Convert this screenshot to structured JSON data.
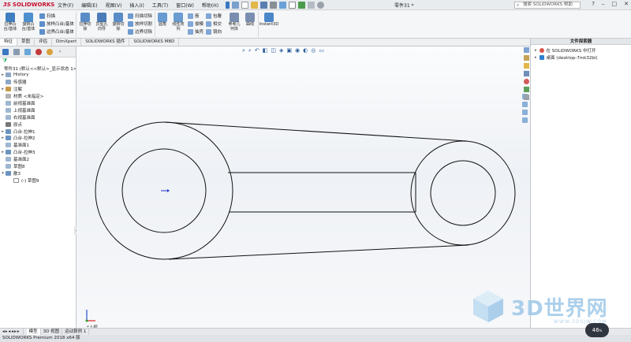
{
  "app": {
    "logo_text": "SOLIDWORKS",
    "document_title": "零件31 *",
    "search_placeholder": "搜索 SOLIDWORKS 帮助",
    "menus": [
      "文件(F)",
      "编辑(E)",
      "视图(V)",
      "插入(I)",
      "工具(T)",
      "窗口(W)",
      "帮助(H)"
    ],
    "window_controls": [
      "?",
      "–",
      "□",
      "✕"
    ]
  },
  "ribbon": {
    "features": [
      {
        "label": "拉伸凸\n台/基体",
        "color": "#3f7fc0"
      },
      {
        "label": "旋转凸\n台/基体",
        "color": "#4e8fce"
      }
    ],
    "boss_small": [
      "扫描",
      "放样凸台/基体",
      "边界凸台/基体"
    ],
    "cuts": [
      {
        "label": "拉伸切\n除",
        "color": "#5a8dc8"
      },
      {
        "label": "异型孔\n向导",
        "color": "#4b7cb8"
      },
      {
        "label": "旋转切\n除",
        "color": "#5a8dc8"
      }
    ],
    "cut_small": [
      "扫描切除",
      "放样切割",
      "边界切除"
    ],
    "fillet": {
      "label": "圆角",
      "color": "#6a9bd1"
    },
    "pattern": {
      "label": "线性阵\n列",
      "color": "#6a9bd1"
    },
    "rib_small": [
      "筋",
      "拔模",
      "抽壳"
    ],
    "wrap_small": [
      "包覆",
      "相交",
      "镜向"
    ],
    "ref_geom": {
      "label": "参考几\n何体",
      "color": "#7a8fb0"
    },
    "curves": {
      "label": "曲线",
      "color": "#7a8fb0"
    },
    "instant3d": {
      "label": "Instant3D",
      "color": "#4a87c9"
    }
  },
  "command_tabs": [
    "特征",
    "草图",
    "评估",
    "DimXpert",
    "SOLIDWORKS 插件",
    "SOLIDWORKS MBD"
  ],
  "feature_tree": {
    "root": "零件31 (默认<<默认>_显示状态 1>)",
    "items": [
      {
        "label": "History",
        "arrow": "▸",
        "color": "#8da7c6"
      },
      {
        "label": "传感器",
        "arrow": "",
        "color": "#8da7c6"
      },
      {
        "label": "注解",
        "arrow": "▸",
        "color": "#c69a4a"
      },
      {
        "label": "材质 <未指定>",
        "arrow": "",
        "color": "#b3b3b3"
      },
      {
        "label": "前视基准面",
        "arrow": "",
        "color": "#9fb6d0"
      },
      {
        "label": "上视基准面",
        "arrow": "",
        "color": "#9fb6d0"
      },
      {
        "label": "右视基准面",
        "arrow": "",
        "color": "#9fb6d0"
      },
      {
        "label": "原点",
        "arrow": "",
        "color": "#777777"
      },
      {
        "label": "凸台-拉伸1",
        "arrow": "▸",
        "color": "#6c93bf"
      },
      {
        "label": "凸台-拉伸2",
        "arrow": "▸",
        "color": "#6c93bf"
      },
      {
        "label": "基准面1",
        "arrow": "",
        "color": "#9fb6d0"
      },
      {
        "label": "凸台-拉伸3",
        "arrow": "▸",
        "color": "#6c93bf"
      },
      {
        "label": "基准面2",
        "arrow": "",
        "color": "#9fb6d0"
      },
      {
        "label": "草图8",
        "arrow": "",
        "color": "#9fb6d0"
      },
      {
        "label": "散3",
        "arrow": "▾",
        "color": "#6c93bf"
      },
      {
        "label": "(-) 草图9",
        "arrow": "",
        "color": "#ffffff",
        "indent": true
      }
    ]
  },
  "graphics": {
    "triad_label": "*上视"
  },
  "task_pane": {
    "title": "文件探索器",
    "items": [
      {
        "label": "在 SOLIDWORKS 中打开",
        "color": "#d9534f"
      },
      {
        "label": "桌面 (desktop-7mk32bi)",
        "color": "#2f7fd0"
      }
    ]
  },
  "bottom_tabs": [
    "模型",
    "3D 视图",
    "运动算例 1"
  ],
  "status_text": "SOLIDWORKS Premium 2018 x64 版",
  "badge": {
    "value": "46",
    "unit": "%"
  },
  "watermark": {
    "text": "3D世界网",
    "url": "WWW.3DSJW.COM"
  }
}
